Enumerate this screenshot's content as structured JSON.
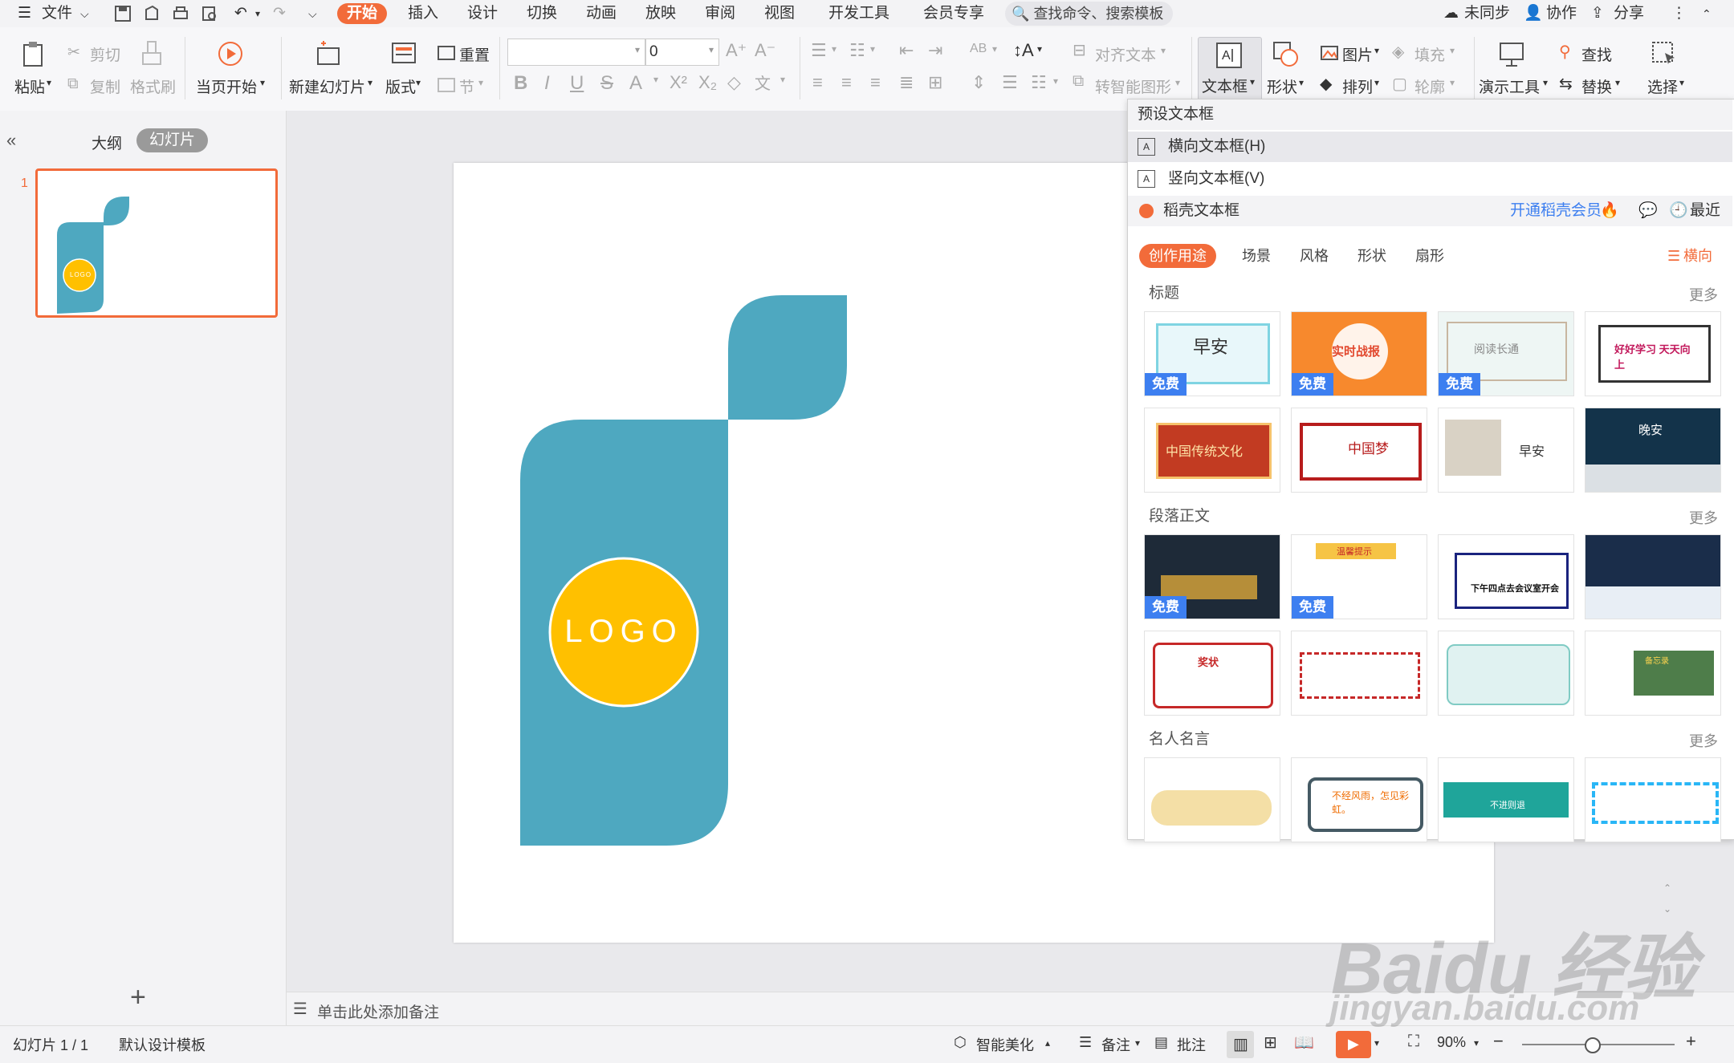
{
  "menubar": {
    "file_label": "文件",
    "items": [
      "开始",
      "插入",
      "设计",
      "切换",
      "动画",
      "放映",
      "审阅",
      "视图",
      "开发工具",
      "会员专享"
    ],
    "active_index": 0,
    "search": "查找命令、搜索模板",
    "sync": "未同步",
    "collab": "协作",
    "share": "分享"
  },
  "ribbon": {
    "paste": "粘贴",
    "cut": "剪切",
    "copy": "复制",
    "format_painter": "格式刷",
    "from_current": "当页开始",
    "new_slide": "新建幻灯片",
    "layout": "版式",
    "reset": "重置",
    "section": "节",
    "font_size": "0",
    "align_text": "对齐文本",
    "smartart": "转智能图形",
    "textbox": "文本框",
    "shape": "形状",
    "picture": "图片",
    "arrange": "排列",
    "fill": "填充",
    "outline": "轮廓",
    "present_tools": "演示工具",
    "find": "查找",
    "replace": "替换",
    "select": "选择"
  },
  "leftpanel": {
    "outline_tab": "大纲",
    "slides_tab": "幻灯片",
    "slide_number": "1",
    "thumb_logo": "LOGO"
  },
  "slide": {
    "logo_text": "LOGO",
    "colors": {
      "teal": "#4ea8c0",
      "yellow": "#ffc000"
    }
  },
  "notes": {
    "placeholder": "单击此处添加备注"
  },
  "status": {
    "slide_info": "幻灯片 1 / 1",
    "template": "默认设计模板",
    "beautify": "智能美化",
    "notes": "备注",
    "comments": "批注",
    "zoom": "90%"
  },
  "dropdown": {
    "preset_header": "预设文本框",
    "horizontal": "横向文本框(H)",
    "vertical": "竖向文本框(V)",
    "daoke": "稻壳文本框",
    "open_member": "开通稻壳会员",
    "recent": "最近",
    "tabs": [
      "创作用途",
      "场景",
      "风格",
      "形状",
      "扇形"
    ],
    "orientation": "横向",
    "sections": [
      {
        "title": "标题",
        "more": "更多",
        "tiles": [
          {
            "text": "早安",
            "free": "免费"
          },
          {
            "text": "实时战报",
            "free": "免费"
          },
          {
            "text": "阅读长通",
            "free": "免费"
          },
          {
            "text": "好好学习 天天向上",
            "free": ""
          },
          {
            "text": "中国传统文化",
            "free": ""
          },
          {
            "text": "中国梦",
            "free": ""
          },
          {
            "text": "早安",
            "free": ""
          },
          {
            "text": "晚安",
            "free": ""
          }
        ]
      },
      {
        "title": "段落正文",
        "more": "更多",
        "tiles": [
          {
            "text": "",
            "free": "免费"
          },
          {
            "text": "温馨提示",
            "free": "免费"
          },
          {
            "text": "下午四点去会议室开会",
            "free": ""
          },
          {
            "text": "",
            "free": ""
          },
          {
            "text": "奖状",
            "free": ""
          },
          {
            "text": "",
            "free": ""
          },
          {
            "text": "",
            "free": ""
          },
          {
            "text": "备忘录",
            "free": ""
          }
        ]
      },
      {
        "title": "名人名言",
        "more": "更多",
        "tiles": [
          {
            "text": "",
            "free": ""
          },
          {
            "text": "不经风雨，怎见彩虹。",
            "free": ""
          },
          {
            "text": "不进则退",
            "free": ""
          },
          {
            "text": "",
            "free": ""
          }
        ]
      }
    ]
  },
  "watermark": {
    "brand": "Baidu 经验",
    "url": "jingyan.baidu.com"
  }
}
